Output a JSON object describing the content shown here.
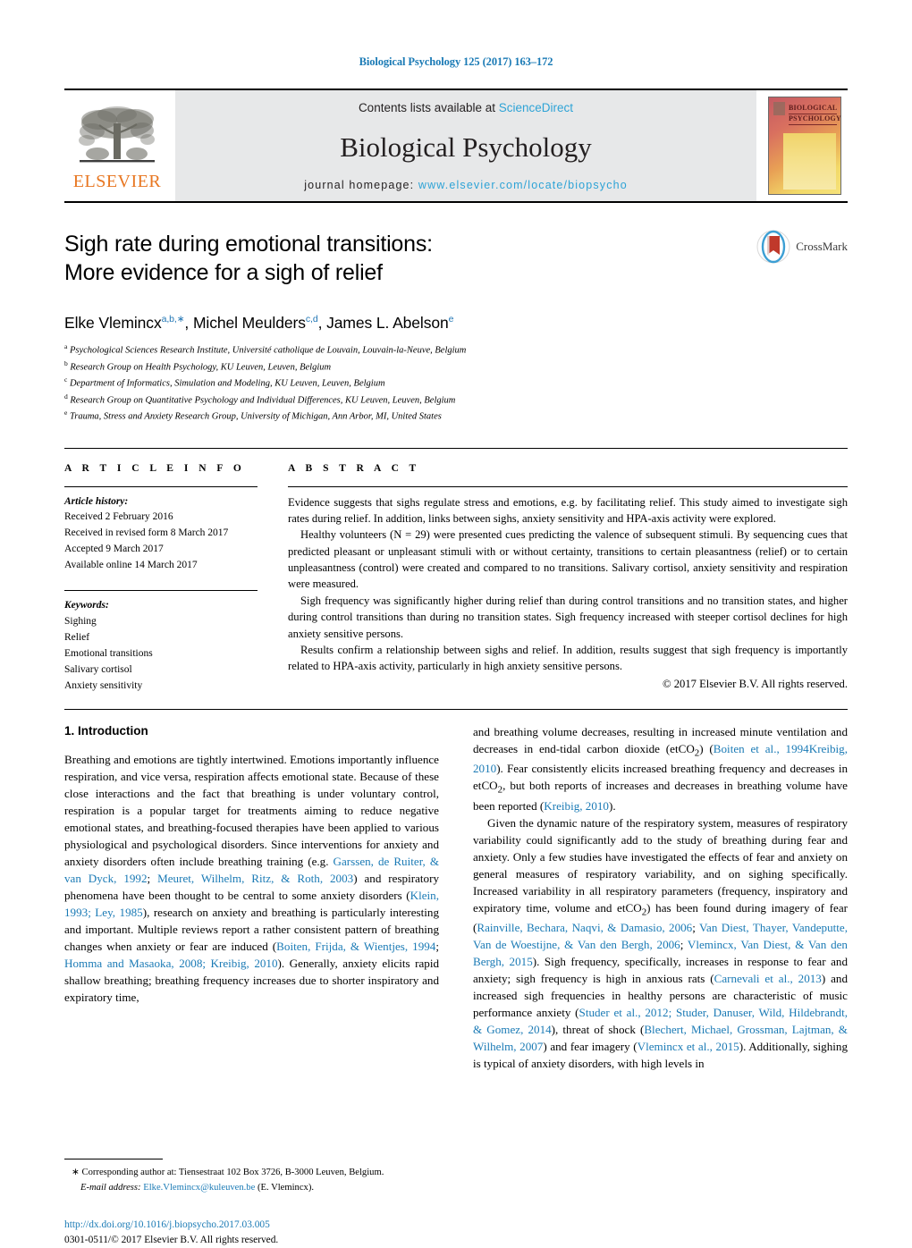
{
  "running_head": "Biological Psychology 125 (2017) 163–172",
  "masthead": {
    "publisher_logo_label": "ELSEVIER",
    "contents_prefix": "Contents lists available at ",
    "contents_link": "ScienceDirect",
    "journal_title": "Biological Psychology",
    "homepage_prefix": "journal homepage: ",
    "homepage_url": "www.elsevier.com/locate/biopsycho",
    "cover_title_line1": "BIOLOGICAL",
    "cover_title_line2": "PSYCHOLOGY"
  },
  "article": {
    "title_line1": "Sigh rate during emotional transitions:",
    "title_line2": "More evidence for a sigh of relief",
    "crossmark_label": "CrossMark",
    "authors_html": "Elke Vlemincx<sup>a,b,∗</sup>, Michel Meulders<sup>c,d</sup>, James L. Abelson<sup>e</sup>",
    "affiliations": [
      {
        "mark": "a",
        "text": "Psychological Sciences Research Institute, Université catholique de Louvain, Louvain-la-Neuve, Belgium"
      },
      {
        "mark": "b",
        "text": "Research Group on Health Psychology, KU Leuven, Leuven, Belgium"
      },
      {
        "mark": "c",
        "text": "Department of Informatics, Simulation and Modeling, KU Leuven, Leuven, Belgium"
      },
      {
        "mark": "d",
        "text": "Research Group on Quantitative Psychology and Individual Differences, KU Leuven, Leuven, Belgium"
      },
      {
        "mark": "e",
        "text": "Trauma, Stress and Anxiety Research Group, University of Michigan, Ann Arbor, MI, United States"
      }
    ]
  },
  "article_info": {
    "heading": "A R T I C L E   I N F O",
    "history_label": "Article history:",
    "history": [
      "Received 2 February 2016",
      "Received in revised form 8 March 2017",
      "Accepted 9 March 2017",
      "Available online 14 March 2017"
    ],
    "keywords_label": "Keywords:",
    "keywords": [
      "Sighing",
      "Relief",
      "Emotional transitions",
      "Salivary cortisol",
      "Anxiety sensitivity"
    ]
  },
  "abstract": {
    "heading": "A B S T R A C T",
    "paragraphs": [
      "Evidence suggests that sighs regulate stress and emotions, e.g. by facilitating relief. This study aimed to investigate sigh rates during relief. In addition, links between sighs, anxiety sensitivity and HPA-axis activity were explored.",
      "Healthy volunteers (N = 29) were presented cues predicting the valence of subsequent stimuli. By sequencing cues that predicted pleasant or unpleasant stimuli with or without certainty, transitions to certain pleasantness (relief) or to certain unpleasantness (control) were created and compared to no transitions. Salivary cortisol, anxiety sensitivity and respiration were measured.",
      "Sigh frequency was significantly higher during relief than during control transitions and no transition states, and higher during control transitions than during no transition states. Sigh frequency increased with steeper cortisol declines for high anxiety sensitive persons.",
      "Results confirm a relationship between sighs and relief. In addition, results suggest that sigh frequency is importantly related to HPA-axis activity, particularly in high anxiety sensitive persons."
    ],
    "copyright": "© 2017 Elsevier B.V. All rights reserved."
  },
  "body": {
    "section_title": "1. Introduction",
    "left_paragraphs_html": [
      "Breathing and emotions are tightly intertwined. Emotions importantly influence respiration, and vice versa, respiration affects emotional state. Because of these close interactions and the fact that breathing is under voluntary control, respiration is a popular target for treatments aiming to reduce negative emotional states, and breathing-focused therapies have been applied to various physiological and psychological disorders. Since interventions for anxiety and anxiety disorders often include breathing training (e.g. <span class=\"ref\">Garssen, de Ruiter, &amp; van Dyck, 1992</span>; <span class=\"ref\">Meuret, Wilhelm, Ritz, &amp; Roth, 2003</span>) and respiratory phenomena have been thought to be central to some anxiety disorders (<span class=\"ref\">Klein, 1993; Ley, 1985</span>), research on anxiety and breathing is particularly interesting and important. Multiple reviews report a rather consistent pattern of breathing changes when anxiety or fear are induced (<span class=\"ref\">Boiten, Frijda, &amp; Wientjes, 1994</span>; <span class=\"ref\">Homma and Masaoka, 2008; Kreibig, 2010</span>). Generally, anxiety elicits rapid shallow breathing; breathing frequency increases due to shorter inspiratory and expiratory time,"
    ],
    "right_paragraphs_html": [
      "and breathing volume decreases, resulting in increased minute ventilation and decreases in end-tidal carbon dioxide (etCO<sub>2</sub>) (<span class=\"ref\">Boiten et al., 1994Kreibig, 2010</span>). Fear consistently elicits increased breathing frequency and decreases in etCO<sub>2</sub>, but both reports of increases and decreases in breathing volume have been reported (<span class=\"ref\">Kreibig, 2010</span>).",
      "Given the dynamic nature of the respiratory system, measures of respiratory variability could significantly add to the study of breathing during fear and anxiety. Only a few studies have investigated the effects of fear and anxiety on general measures of respiratory variability, and on sighing specifically. Increased variability in all respiratory parameters (frequency, inspiratory and expiratory time, volume and etCO<sub>2</sub>) has been found during imagery of fear (<span class=\"ref\">Rainville, Bechara, Naqvi, &amp; Damasio, 2006</span>; <span class=\"ref\">Van Diest, Thayer, Vandeputte, Van de Woestijne, &amp; Van den Bergh, 2006</span>; <span class=\"ref\">Vlemincx, Van Diest, &amp; Van den Bergh, 2015</span>). Sigh frequency, specifically, increases in response to fear and anxiety; sigh frequency is high in anxious rats (<span class=\"ref\">Carnevali et al., 2013</span>) and increased sigh frequencies in healthy persons are characteristic of music performance anxiety (<span class=\"ref\">Studer et al., 2012; Studer, Danuser, Wild, Hildebrandt, &amp; Gomez, 2014</span>), threat of shock (<span class=\"ref\">Blechert, Michael, Grossman, Lajtman, &amp; Wilhelm, 2007</span>) and fear imagery (<span class=\"ref\">Vlemincx et al., 2015</span>). Additionally, sighing is typical of anxiety disorders, with high levels in"
    ]
  },
  "footer": {
    "corresponding_marker": "∗",
    "corresponding_text": "Corresponding author at: Tiensestraat 102 Box 3726, B-3000 Leuven, Belgium.",
    "email_label": "E-mail address:",
    "email": "Elke.Vlemincx@kuleuven.be",
    "email_suffix": "(E. Vlemincx).",
    "doi_url": "http://dx.doi.org/10.1016/j.biopsycho.2017.03.005",
    "issn_line": "0301-0511/© 2017 Elsevier B.V. All rights reserved."
  },
  "colors": {
    "link_blue": "#1a7ab5",
    "sciencedirect_blue": "#2ea3d6",
    "elsevier_orange": "#e87722",
    "masthead_gray": "#e7e8e9"
  }
}
